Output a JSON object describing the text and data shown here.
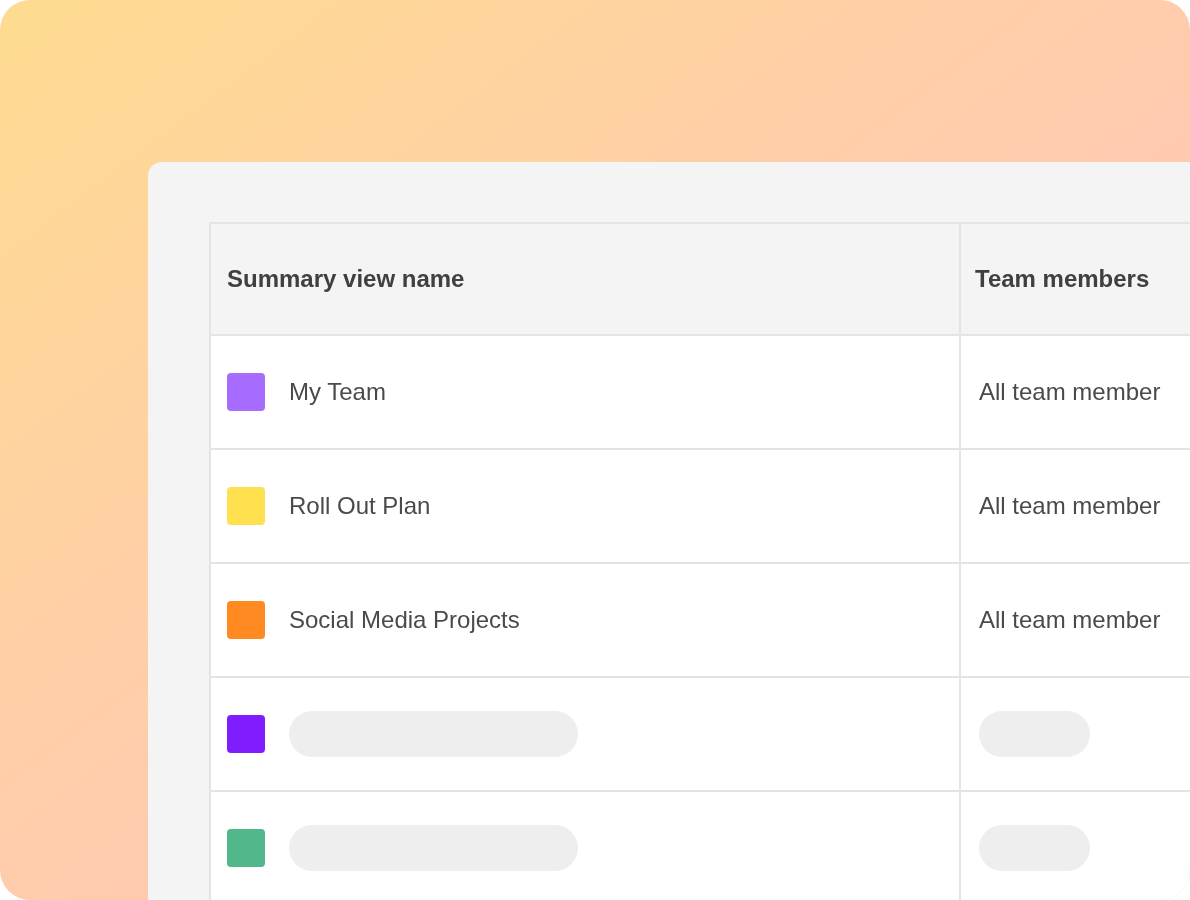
{
  "table": {
    "columns": [
      "Summary view name",
      "Team members"
    ],
    "rows": [
      {
        "kind": "entry",
        "color": "#a66cff",
        "name": "My Team",
        "members": "All team member"
      },
      {
        "kind": "entry",
        "color": "#ffe14f",
        "name": "Roll Out Plan",
        "members": "All team member"
      },
      {
        "kind": "entry",
        "color": "#ff8a22",
        "name": "Social Media Projects",
        "members": "All team member"
      },
      {
        "kind": "placeholder",
        "color": "#7f1dff"
      },
      {
        "kind": "placeholder",
        "color": "#52b78b"
      }
    ]
  }
}
